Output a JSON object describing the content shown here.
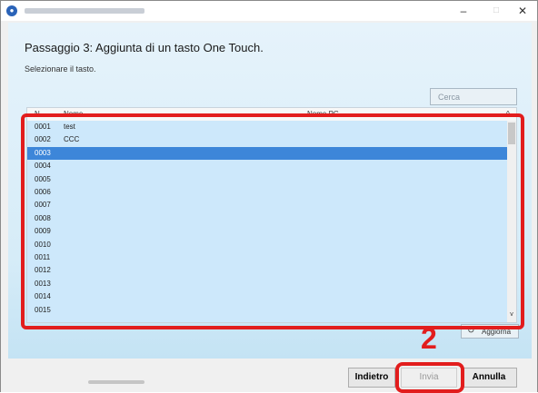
{
  "window": {
    "minimize": "–",
    "maximize": "□",
    "close": "✕"
  },
  "wizard": {
    "heading": "Passaggio 3: Aggiunta di un tasto One Touch.",
    "subtitle": "Selezionare il tasto.",
    "search_placeholder": "Cerca"
  },
  "table": {
    "columns": [
      "N.",
      "Nome",
      "Nome PC"
    ],
    "rows": [
      {
        "n": "0001",
        "nome": "test"
      },
      {
        "n": "0002",
        "nome": "CCC"
      },
      {
        "n": "0003",
        "nome": "",
        "selected": true
      },
      {
        "n": "0004",
        "nome": ""
      },
      {
        "n": "0005",
        "nome": ""
      },
      {
        "n": "0006",
        "nome": ""
      },
      {
        "n": "0007",
        "nome": ""
      },
      {
        "n": "0008",
        "nome": ""
      },
      {
        "n": "0009",
        "nome": ""
      },
      {
        "n": "0010",
        "nome": ""
      },
      {
        "n": "0011",
        "nome": ""
      },
      {
        "n": "0012",
        "nome": ""
      },
      {
        "n": "0013",
        "nome": ""
      },
      {
        "n": "0014",
        "nome": ""
      },
      {
        "n": "0015",
        "nome": ""
      }
    ]
  },
  "refresh": {
    "label": "Aggiorna",
    "icon": "refresh-icon"
  },
  "buttons": {
    "back": "Indietro",
    "send": "Invia",
    "cancel": "Annulla"
  },
  "annotation": {
    "callout_number": "2",
    "color": "#e21d1d"
  },
  "colors": {
    "selected_row": "#3d86d9",
    "table_background": "#cde8fb"
  }
}
